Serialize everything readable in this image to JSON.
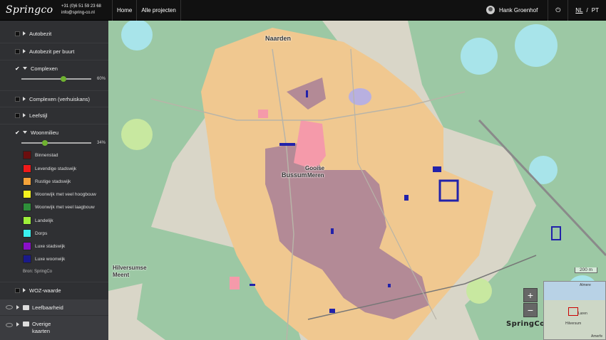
{
  "header": {
    "logo": "Springco",
    "phone": "+31 (0)6 51 59 23 68",
    "email": "info@spring-co.nl",
    "nav": [
      "Home",
      "Alle projecten"
    ],
    "user_name": "Hank Groenhof",
    "power_icon": "⏻",
    "lang_active": "NL",
    "lang_sep": "/",
    "lang_other": "PT"
  },
  "sidebar": {
    "layers": [
      {
        "label": "Autobezit",
        "checked": false
      },
      {
        "label": "Autobezit per buurt",
        "checked": false
      },
      {
        "label": "Complexen",
        "checked": true,
        "opacity": "60%",
        "opacity_value": 0.6
      },
      {
        "label": "Complexen (verhuiskans)",
        "checked": false
      },
      {
        "label": "Leefstijl",
        "checked": false
      },
      {
        "label": "Woonmilieu",
        "checked": true,
        "opacity": "34%",
        "opacity_value": 0.34
      },
      {
        "label": "WOZ-waarde",
        "checked": false
      }
    ],
    "legend": [
      {
        "label": "Binnenstad",
        "color": "#6b0e0e"
      },
      {
        "label": "Levendige stadswijk",
        "color": "#f01a1a"
      },
      {
        "label": "Rustige stadswijk",
        "color": "#f5a23a"
      },
      {
        "label": "Woonwijk met veel hoogbouw",
        "color": "#f5f21e"
      },
      {
        "label": "Woonwijk met veel laagbouw",
        "color": "#2e8f3a"
      },
      {
        "label": "Landelijk",
        "color": "#9ef03a"
      },
      {
        "label": "Dorps",
        "color": "#3af0f0"
      },
      {
        "label": "Luxe stadswijk",
        "color": "#8a10c8"
      },
      {
        "label": "Luxe woonwijk",
        "color": "#1a1a8a"
      }
    ],
    "source": "Bron: SpringCo",
    "groups": [
      "Leefbaarheid",
      "Overige kaarten"
    ]
  },
  "map": {
    "labels": {
      "naarden": "Naarden",
      "bussum": "Bussum",
      "gooise": "Gooise",
      "meren": "Meren",
      "hilversumse": "Hilversumse",
      "meent": "Meent"
    },
    "zoom_in": "+",
    "zoom_out": "−",
    "scale": "200 m",
    "brand": "SpringCo",
    "minimap_labels": {
      "almere": "Almere",
      "laren": "Laren",
      "hilversum": "Hilversum",
      "amersfoort": "Amerfe"
    }
  }
}
